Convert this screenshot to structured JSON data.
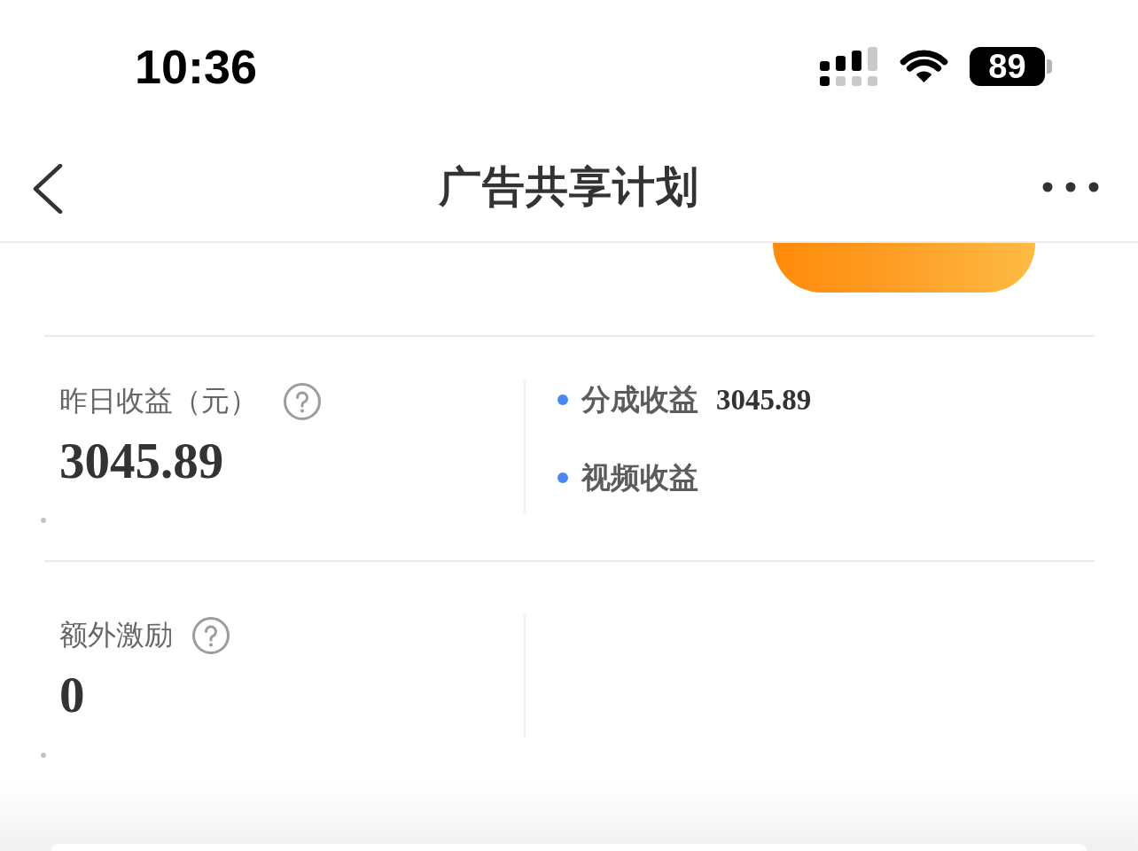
{
  "status_bar": {
    "time": "10:36",
    "battery": "89"
  },
  "nav_bar": {
    "title": "广告共享计划"
  },
  "stats": [
    {
      "label": "昨日收益（元）",
      "value": "3045.89",
      "breakdown": [
        {
          "label": "分成收益",
          "value": "3045.89"
        },
        {
          "label": "视频收益"
        }
      ]
    },
    {
      "label": "额外激励",
      "value": "0"
    }
  ]
}
